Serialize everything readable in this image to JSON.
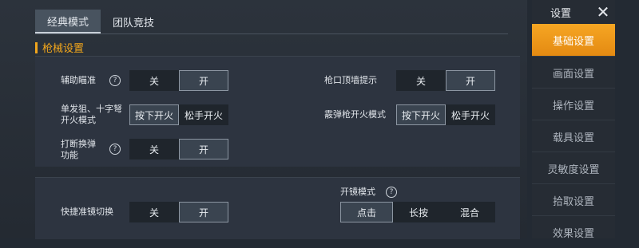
{
  "tabs": [
    "经典模式",
    "团队竞技"
  ],
  "section": "枪械设置",
  "panel1": {
    "aim_assist": {
      "label": "辅助瞄准",
      "help": "?",
      "options": [
        "关",
        "开"
      ]
    },
    "muzzle_hint": {
      "label": "枪口顶墙提示",
      "options": [
        "关",
        "开"
      ]
    },
    "sniper_fire_mode": {
      "label": "单发狙、十字弩\n开火模式",
      "options": [
        "按下开火",
        "松手开火"
      ]
    },
    "shotgun_fire_mode": {
      "label": "霰弹枪开火模式",
      "options": [
        "按下开火",
        "松手开火"
      ]
    },
    "interrupt_reload": {
      "label": "打断换弹\n功能",
      "help": "?",
      "options": [
        "关",
        "开"
      ]
    }
  },
  "panel2": {
    "quick_scope_switch": {
      "label": "快捷准镜切换",
      "options": [
        "关",
        "开"
      ]
    },
    "scope_mode": {
      "label": "开镜模式",
      "help": "?",
      "options": [
        "点击",
        "长按",
        "混合"
      ]
    }
  },
  "sidebar": {
    "title": "设置",
    "close": "✕",
    "items": [
      "基础设置",
      "画面设置",
      "操作设置",
      "载具设置",
      "灵敏度设置",
      "拾取设置",
      "效果设置"
    ]
  },
  "colors": {
    "accent": "#f0a51c",
    "panel": "#2d3440"
  }
}
